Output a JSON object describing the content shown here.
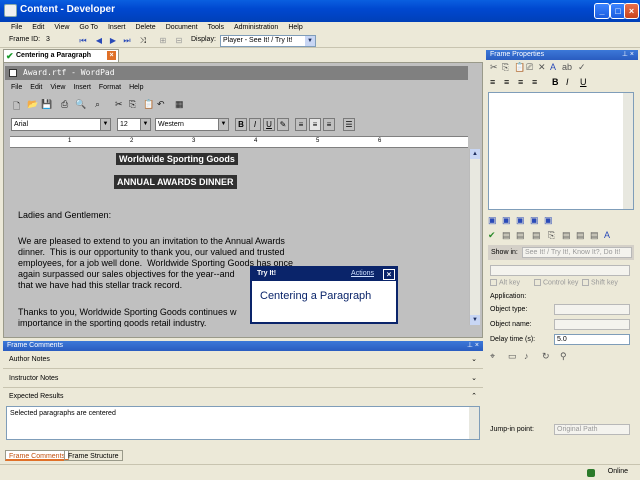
{
  "window": {
    "title": "Content - Developer"
  },
  "menu": [
    "File",
    "Edit",
    "View",
    "Go To",
    "Insert",
    "Delete",
    "Document",
    "Tools",
    "Administration",
    "Help"
  ],
  "toolbar": {
    "frame_id_label": "Frame ID:",
    "frame_id_value": "3",
    "display_label": "Display:",
    "display_value": "Player - See It! / Try It!"
  },
  "doc_tab": {
    "label": "Centering a Paragraph"
  },
  "wordpad": {
    "title": "Award.rtf - WordPad",
    "menu": [
      "File",
      "Edit",
      "View",
      "Insert",
      "Format",
      "Help"
    ],
    "font": "Arial",
    "size": "12",
    "script": "Western",
    "ruler_numbers": [
      "1",
      "2",
      "3",
      "4",
      "5",
      "6"
    ],
    "heading1": "Worldwide Sporting Goods",
    "heading2": "ANNUAL AWARDS DINNER",
    "salutation": "Ladies and Gentlemen:",
    "para1": [
      "We are pleased to extend to you an invitation to the Annual Awards",
      "dinner.  This is our opportunity to thank you, our valued and trusted",
      "employees, for a job well done.  Worldwide Sporting Goods has once",
      "again surpassed our sales objectives for the year--and",
      "that we have had this stellar track record."
    ],
    "para2": [
      "Thanks to you, Worldwide Sporting Goods continues w",
      "importance in the sporting goods retail industry."
    ]
  },
  "tryit": {
    "title": "Try It!",
    "actions": "Actions",
    "body": "Centering a Paragraph"
  },
  "frame_comments": {
    "header": "Frame Comments",
    "author_notes": "Author Notes",
    "instructor_notes": "Instructor Notes",
    "expected_results": "Expected Results",
    "expected_text": "Selected paragraphs are centered",
    "tabs": [
      "Frame Comments",
      "Frame Structure"
    ]
  },
  "frame_properties": {
    "header": "Frame Properties",
    "show_in_label": "Show in:",
    "show_in_value": "See It! / Try It!, Know It?, Do It!",
    "alt_key": "Alt key",
    "control_key": "Control key",
    "shift_key": "Shift key",
    "application_label": "Application:",
    "object_type_label": "Object type:",
    "object_name_label": "Object name:",
    "delay_label": "Delay time (s):",
    "delay_value": "5.0",
    "jump_in_label": "Jump-in point:",
    "jump_in_value": "Original Path"
  },
  "status": {
    "online": "Online"
  }
}
